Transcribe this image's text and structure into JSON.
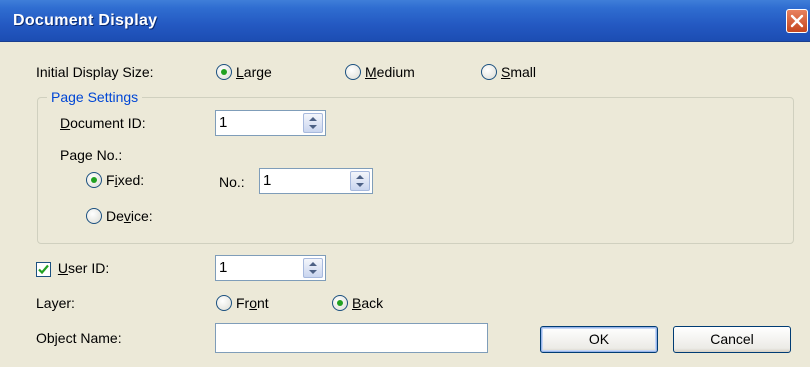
{
  "window": {
    "title": "Document Display"
  },
  "initial_display": {
    "label_pre": "Initial Display Size:",
    "options": [
      {
        "pre": "",
        "key": "L",
        "post": "arge",
        "selected": true
      },
      {
        "pre": "",
        "key": "M",
        "post": "edium",
        "selected": false
      },
      {
        "pre": "",
        "key": "S",
        "post": "mall",
        "selected": false
      }
    ]
  },
  "page_settings": {
    "group_label": "Page Settings",
    "document_id": {
      "key": "D",
      "post": "ocument ID:",
      "value": "1"
    },
    "page_no_label": "Page No.:",
    "fixed": {
      "pre": "F",
      "key": "i",
      "post": "xed:",
      "selected": true
    },
    "no_label": "No.:",
    "no_value": "1",
    "device": {
      "pre": "De",
      "key": "v",
      "post": "ice:",
      "selected": false
    }
  },
  "user_id": {
    "checked": true,
    "key": "U",
    "post": "ser ID:",
    "value": "1"
  },
  "layer": {
    "label": "Layer:",
    "front": {
      "pre": "Fr",
      "key": "o",
      "post": "nt",
      "selected": false
    },
    "back": {
      "pre": "",
      "key": "B",
      "post": "ack",
      "selected": true
    }
  },
  "object_name": {
    "label": "Object Name:",
    "value": ""
  },
  "buttons": {
    "ok": "OK",
    "cancel": "Cancel"
  }
}
